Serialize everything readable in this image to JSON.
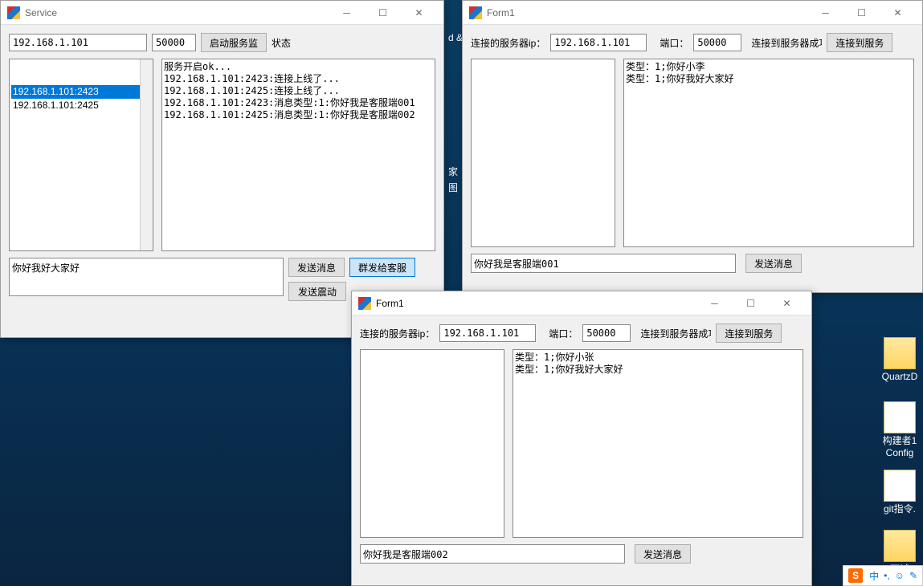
{
  "service": {
    "title": "Service",
    "ip": "192.168.1.101",
    "port": "50000",
    "btn_start": "启动服务监",
    "status_label": "状态",
    "clients": [
      {
        "text": "192.168.1.101:2423",
        "selected": true
      },
      {
        "text": "192.168.1.101:2425",
        "selected": false
      }
    ],
    "log_lines": [
      "服务开启ok...",
      "192.168.1.101:2423:连接上线了...",
      "192.168.1.101:2425:连接上线了...",
      "192.168.1.101:2423:消息类型:1:你好我是客服端001",
      "192.168.1.101:2425:消息类型:1:你好我是客服端002"
    ],
    "msg": "你好我好大家好",
    "btn_send": "发送消息",
    "btn_broadcast": "群发给客服",
    "btn_shake": "发送震动"
  },
  "form1a": {
    "title": "Form1",
    "lbl_ip": "连接的服务器ip：",
    "ip": "192.168.1.101",
    "lbl_port": "端口：",
    "port": "50000",
    "status": "连接到服务器成功",
    "btn_connect": "连接到服务",
    "log_lines": [
      "类型：1;你好小李",
      "类型：1;你好我好大家好"
    ],
    "msg": "你好我是客服端001",
    "btn_send": "发送消息"
  },
  "form1b": {
    "title": "Form1",
    "lbl_ip": "连接的服务器ip：",
    "ip": "192.168.1.101",
    "lbl_port": "端口：",
    "port": "50000",
    "status": "连接到服务器成功",
    "btn_connect": "连接到服务",
    "log_lines": [
      "类型：1;你好小张",
      "类型：1;你好我好大家好"
    ],
    "msg": "你好我是客服端002",
    "btn_send": "发送消息"
  },
  "desktop": {
    "frag1": "d &",
    "frag2": "家",
    "frag3": "图",
    "icons": [
      {
        "label": "QuartzD"
      },
      {
        "label": "构建者1\nConfig"
      },
      {
        "label": "git指令."
      },
      {
        "label": "面试"
      }
    ]
  },
  "ime": {
    "s": "S",
    "mid": "中",
    "items": [
      "•,",
      "☺",
      "✎"
    ]
  }
}
